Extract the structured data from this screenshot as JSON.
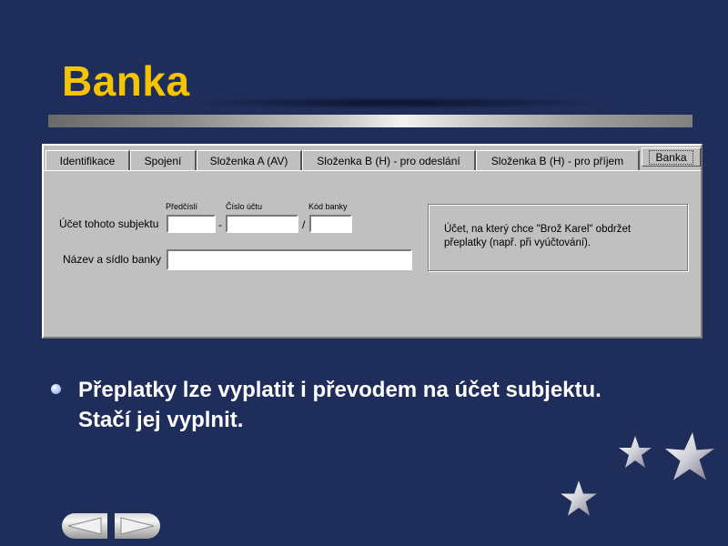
{
  "slide": {
    "title": "Banka",
    "bullet_text_line1": "Přeplatky lze vyplatit i převodem na účet subjektu.",
    "bullet_text_line2": "Stačí jej vyplnit."
  },
  "dialog": {
    "tabs": [
      {
        "label": "Identifikace"
      },
      {
        "label": "Spojení"
      },
      {
        "label": "Složenka A (AV)"
      },
      {
        "label": "Složenka B (H) - pro odeslání"
      },
      {
        "label": "Složenka B (H) - pro příjem"
      },
      {
        "label": "Banka",
        "active": true
      }
    ],
    "account": {
      "label": "Účet tohoto subjektu",
      "prefix_label": "Předčíslí",
      "number_label": "Číslo účtu",
      "bank_code_label": "Kód banky",
      "separator_dash": "-",
      "separator_slash": "/",
      "prefix_value": "",
      "number_value": "",
      "bank_code_value": ""
    },
    "bank_name": {
      "label": "Název a sídlo banky",
      "value": ""
    },
    "info_text": "Účet, na který chce \"Brož Karel\" obdržet přeplatky (např. při vyúčtování)."
  },
  "colors": {
    "background": "#1f2d5a",
    "title": "#f5c400",
    "dialog": "#c0c0c0"
  },
  "icons": [
    "star-icon",
    "prev-arrow-icon",
    "next-arrow-icon",
    "bullet-icon"
  ]
}
